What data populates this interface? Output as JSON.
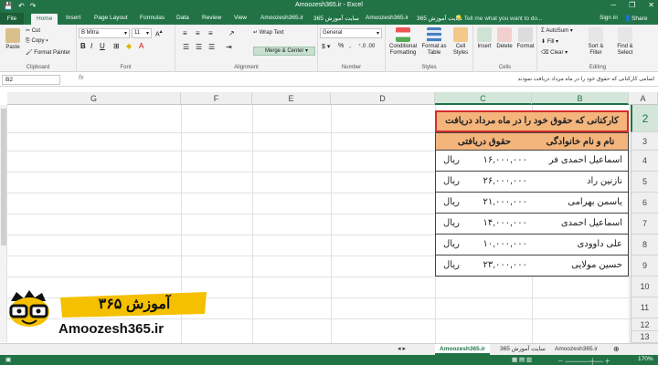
{
  "window": {
    "title": "Amoozesh365.ir - Excel",
    "minimize": "─",
    "restore": "❐",
    "close": "✕"
  },
  "tabs": [
    "File",
    "Home",
    "Insert",
    "Page Layout",
    "Formulas",
    "Data",
    "Review",
    "View",
    "Amoozesh365.ir",
    "سایت آموزش 365",
    "Amoozesh365.ir",
    "سایت آموزش 365"
  ],
  "tell_me": "Tell me what you want to do...",
  "sign_in": "Sign in",
  "share": "Share",
  "ribbon": {
    "clipboard": {
      "label": "Clipboard",
      "paste": "Paste",
      "cut": "Cut",
      "copy": "Copy",
      "format_painter": "Format Painter"
    },
    "font": {
      "label": "Font",
      "name": "B Mitra",
      "size": "11"
    },
    "alignment": {
      "label": "Alignment",
      "wrap": "Wrap Text",
      "merge": "Merge & Center"
    },
    "number": {
      "label": "Number",
      "format": "General"
    },
    "styles": {
      "label": "Styles",
      "conditional": "Conditional Formatting",
      "format_table": "Format as Table",
      "cell_styles": "Cell Styles"
    },
    "cells": {
      "label": "Cells",
      "insert": "Insert",
      "delete": "Delete",
      "format": "Format"
    },
    "editing": {
      "label": "Editing",
      "autosum": "AutoSum",
      "fill": "Fill",
      "clear": "Clear",
      "sort": "Sort & Filter",
      "find": "Find & Select"
    }
  },
  "formula_bar": {
    "name_box": "B2",
    "fx": "fx",
    "value": "اسامی کارکنانی که حقوق خود را در ماه مرداد دریافت نمودند"
  },
  "columns": [
    "G",
    "F",
    "E",
    "D",
    "C",
    "B",
    "A"
  ],
  "rows": [
    "2",
    "3",
    "4",
    "5",
    "6",
    "7",
    "8",
    "9",
    "10",
    "11",
    "12",
    "13"
  ],
  "table": {
    "title": "کارکنانی که حقوق خود را در ماه مرداد دریافت",
    "headers": {
      "name": "نام و نام خانوادگی",
      "salary": "حقوق دریافتی"
    },
    "currency": "ریال",
    "rows": [
      {
        "name": "اسماعیل احمدی فر",
        "salary": "۱۶,۰۰۰,۰۰۰"
      },
      {
        "name": "نازنین راد",
        "salary": "۲۶,۰۰۰,۰۰۰"
      },
      {
        "name": "یاسمن بهرامی",
        "salary": "۲۱,۰۰۰,۰۰۰"
      },
      {
        "name": "اسماعیل احمدی",
        "salary": "۱۴,۰۰۰,۰۰۰"
      },
      {
        "name": "علی داوودی",
        "salary": "۱۰,۰۰۰,۰۰۰"
      },
      {
        "name": "حسین مولایی",
        "salary": "۲۳,۰۰۰,۰۰۰"
      }
    ]
  },
  "sheets": [
    "Amoozesh365.ir",
    "سایت آموزش 365",
    "Amoozesh365.ir"
  ],
  "zoom": "170%",
  "logo": {
    "text": "Amoozesh365.ir",
    "persian": "آموزش ۳۶۵"
  },
  "colors": {
    "excel_green": "#217346",
    "header_fill": "#f4b57c",
    "highlight_border": "#d42d2d"
  }
}
